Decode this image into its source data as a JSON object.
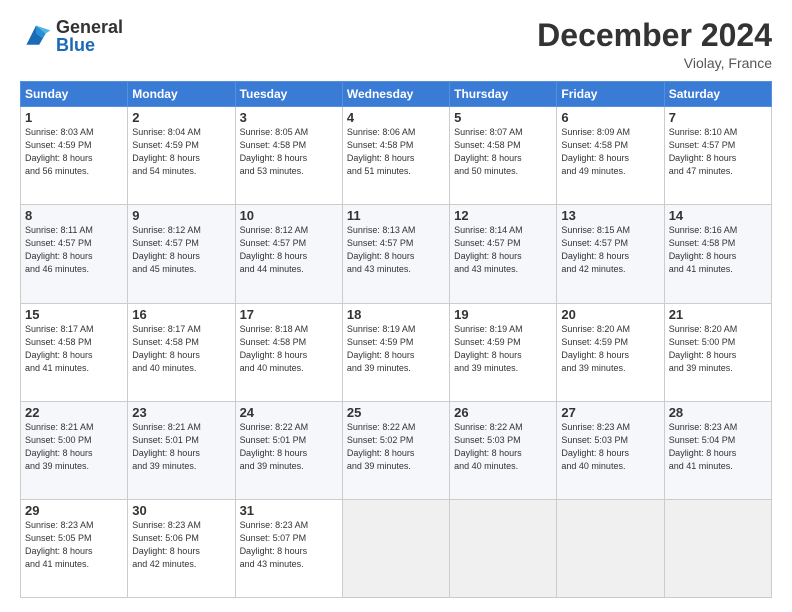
{
  "header": {
    "logo_general": "General",
    "logo_blue": "Blue",
    "month_title": "December 2024",
    "location": "Violay, France"
  },
  "days_of_week": [
    "Sunday",
    "Monday",
    "Tuesday",
    "Wednesday",
    "Thursday",
    "Friday",
    "Saturday"
  ],
  "weeks": [
    [
      {
        "day": "1",
        "info": "Sunrise: 8:03 AM\nSunset: 4:59 PM\nDaylight: 8 hours\nand 56 minutes."
      },
      {
        "day": "2",
        "info": "Sunrise: 8:04 AM\nSunset: 4:59 PM\nDaylight: 8 hours\nand 54 minutes."
      },
      {
        "day": "3",
        "info": "Sunrise: 8:05 AM\nSunset: 4:58 PM\nDaylight: 8 hours\nand 53 minutes."
      },
      {
        "day": "4",
        "info": "Sunrise: 8:06 AM\nSunset: 4:58 PM\nDaylight: 8 hours\nand 51 minutes."
      },
      {
        "day": "5",
        "info": "Sunrise: 8:07 AM\nSunset: 4:58 PM\nDaylight: 8 hours\nand 50 minutes."
      },
      {
        "day": "6",
        "info": "Sunrise: 8:09 AM\nSunset: 4:58 PM\nDaylight: 8 hours\nand 49 minutes."
      },
      {
        "day": "7",
        "info": "Sunrise: 8:10 AM\nSunset: 4:57 PM\nDaylight: 8 hours\nand 47 minutes."
      }
    ],
    [
      {
        "day": "8",
        "info": "Sunrise: 8:11 AM\nSunset: 4:57 PM\nDaylight: 8 hours\nand 46 minutes."
      },
      {
        "day": "9",
        "info": "Sunrise: 8:12 AM\nSunset: 4:57 PM\nDaylight: 8 hours\nand 45 minutes."
      },
      {
        "day": "10",
        "info": "Sunrise: 8:12 AM\nSunset: 4:57 PM\nDaylight: 8 hours\nand 44 minutes."
      },
      {
        "day": "11",
        "info": "Sunrise: 8:13 AM\nSunset: 4:57 PM\nDaylight: 8 hours\nand 43 minutes."
      },
      {
        "day": "12",
        "info": "Sunrise: 8:14 AM\nSunset: 4:57 PM\nDaylight: 8 hours\nand 43 minutes."
      },
      {
        "day": "13",
        "info": "Sunrise: 8:15 AM\nSunset: 4:57 PM\nDaylight: 8 hours\nand 42 minutes."
      },
      {
        "day": "14",
        "info": "Sunrise: 8:16 AM\nSunset: 4:58 PM\nDaylight: 8 hours\nand 41 minutes."
      }
    ],
    [
      {
        "day": "15",
        "info": "Sunrise: 8:17 AM\nSunset: 4:58 PM\nDaylight: 8 hours\nand 41 minutes."
      },
      {
        "day": "16",
        "info": "Sunrise: 8:17 AM\nSunset: 4:58 PM\nDaylight: 8 hours\nand 40 minutes."
      },
      {
        "day": "17",
        "info": "Sunrise: 8:18 AM\nSunset: 4:58 PM\nDaylight: 8 hours\nand 40 minutes."
      },
      {
        "day": "18",
        "info": "Sunrise: 8:19 AM\nSunset: 4:59 PM\nDaylight: 8 hours\nand 39 minutes."
      },
      {
        "day": "19",
        "info": "Sunrise: 8:19 AM\nSunset: 4:59 PM\nDaylight: 8 hours\nand 39 minutes."
      },
      {
        "day": "20",
        "info": "Sunrise: 8:20 AM\nSunset: 4:59 PM\nDaylight: 8 hours\nand 39 minutes."
      },
      {
        "day": "21",
        "info": "Sunrise: 8:20 AM\nSunset: 5:00 PM\nDaylight: 8 hours\nand 39 minutes."
      }
    ],
    [
      {
        "day": "22",
        "info": "Sunrise: 8:21 AM\nSunset: 5:00 PM\nDaylight: 8 hours\nand 39 minutes."
      },
      {
        "day": "23",
        "info": "Sunrise: 8:21 AM\nSunset: 5:01 PM\nDaylight: 8 hours\nand 39 minutes."
      },
      {
        "day": "24",
        "info": "Sunrise: 8:22 AM\nSunset: 5:01 PM\nDaylight: 8 hours\nand 39 minutes."
      },
      {
        "day": "25",
        "info": "Sunrise: 8:22 AM\nSunset: 5:02 PM\nDaylight: 8 hours\nand 39 minutes."
      },
      {
        "day": "26",
        "info": "Sunrise: 8:22 AM\nSunset: 5:03 PM\nDaylight: 8 hours\nand 40 minutes."
      },
      {
        "day": "27",
        "info": "Sunrise: 8:23 AM\nSunset: 5:03 PM\nDaylight: 8 hours\nand 40 minutes."
      },
      {
        "day": "28",
        "info": "Sunrise: 8:23 AM\nSunset: 5:04 PM\nDaylight: 8 hours\nand 41 minutes."
      }
    ],
    [
      {
        "day": "29",
        "info": "Sunrise: 8:23 AM\nSunset: 5:05 PM\nDaylight: 8 hours\nand 41 minutes."
      },
      {
        "day": "30",
        "info": "Sunrise: 8:23 AM\nSunset: 5:06 PM\nDaylight: 8 hours\nand 42 minutes."
      },
      {
        "day": "31",
        "info": "Sunrise: 8:23 AM\nSunset: 5:07 PM\nDaylight: 8 hours\nand 43 minutes."
      },
      {
        "day": "",
        "info": ""
      },
      {
        "day": "",
        "info": ""
      },
      {
        "day": "",
        "info": ""
      },
      {
        "day": "",
        "info": ""
      }
    ]
  ]
}
